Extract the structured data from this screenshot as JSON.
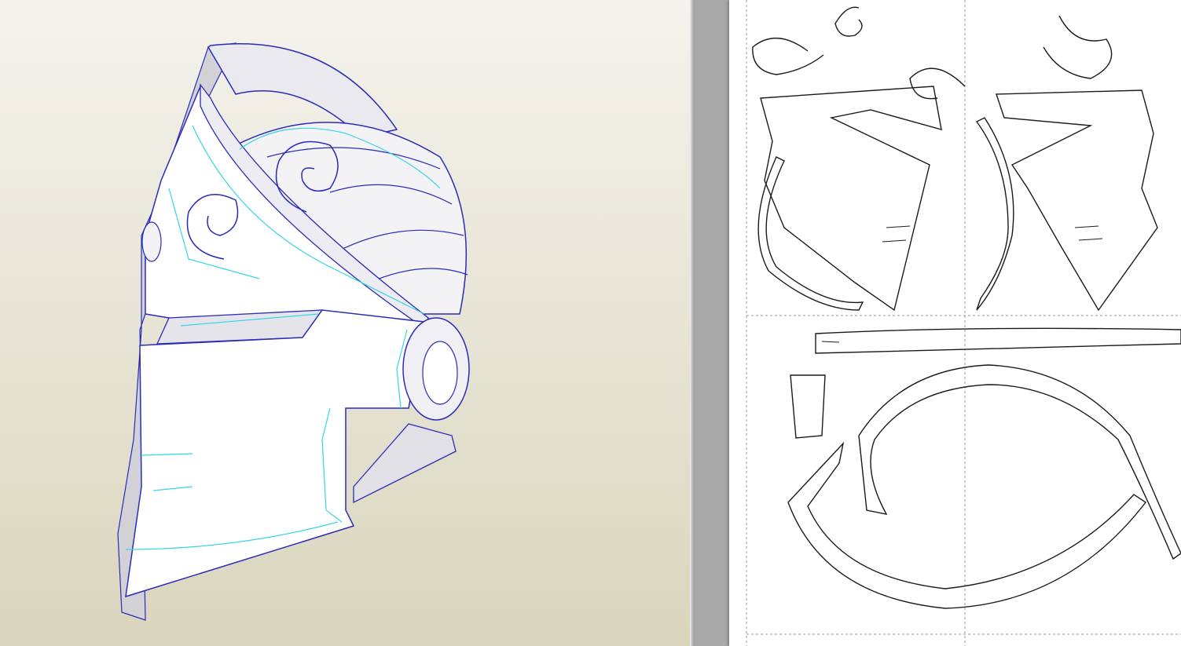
{
  "app": {
    "panes": [
      "3d-model-view",
      "2d-unfold-view"
    ]
  },
  "model_view": {
    "object": "helmet",
    "colors": {
      "background_top": "#f4f3ed",
      "background_bottom": "#d9d5bd",
      "edge_outline": "#2b2bb8",
      "fold_line": "#33d6e6",
      "surface": "#ffffff",
      "shade": "#d2d2d6"
    }
  },
  "unfold_view": {
    "colors": {
      "canvas": "#a9a9a9",
      "paper": "#ffffff",
      "cut_line": "#1a1a1a",
      "page_border": "#9a9a9a"
    }
  }
}
